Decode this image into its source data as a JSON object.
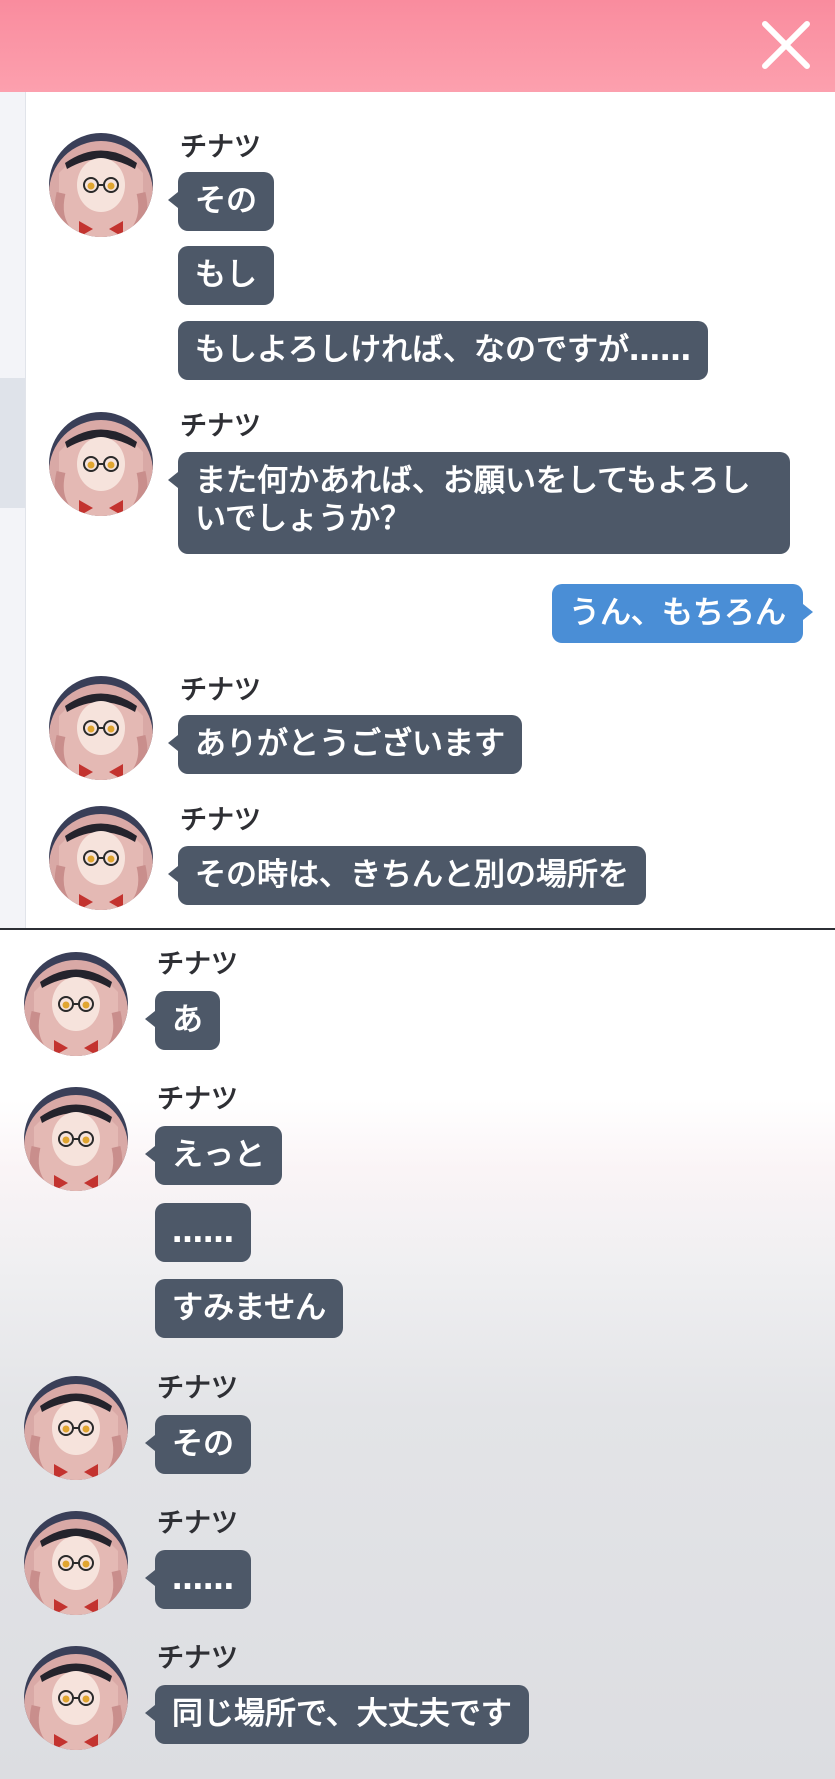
{
  "header": {
    "close_icon": "close-icon",
    "color": "#f98c9e"
  },
  "colors": {
    "npc_bubble": "#4d5868",
    "player_bubble": "#4a8ed6"
  },
  "top_chat": [
    {
      "name": "チナツ",
      "messages": [
        "その",
        "もし",
        "もしよろしければ、なのですが……"
      ]
    },
    {
      "name": "チナツ",
      "messages": [
        "また何かあれば、お願いをしてもよろしいでしょうか？"
      ]
    },
    {
      "player": "うん、もちろん"
    },
    {
      "name": "チナツ",
      "messages": [
        "ありがとうございます"
      ]
    },
    {
      "name": "チナツ",
      "messages": [
        "その時は、きちんと別の場所を"
      ]
    }
  ],
  "bottom_chat": [
    {
      "name": "チナツ",
      "messages": [
        "あ"
      ]
    },
    {
      "name": "チナツ",
      "messages": [
        "えっと",
        "……",
        "すみません"
      ]
    },
    {
      "name": "チナツ",
      "messages": [
        "その"
      ]
    },
    {
      "name": "チナツ",
      "messages": [
        "……"
      ]
    },
    {
      "name": "チナツ",
      "messages": [
        "同じ場所で、大丈夫です"
      ]
    }
  ]
}
